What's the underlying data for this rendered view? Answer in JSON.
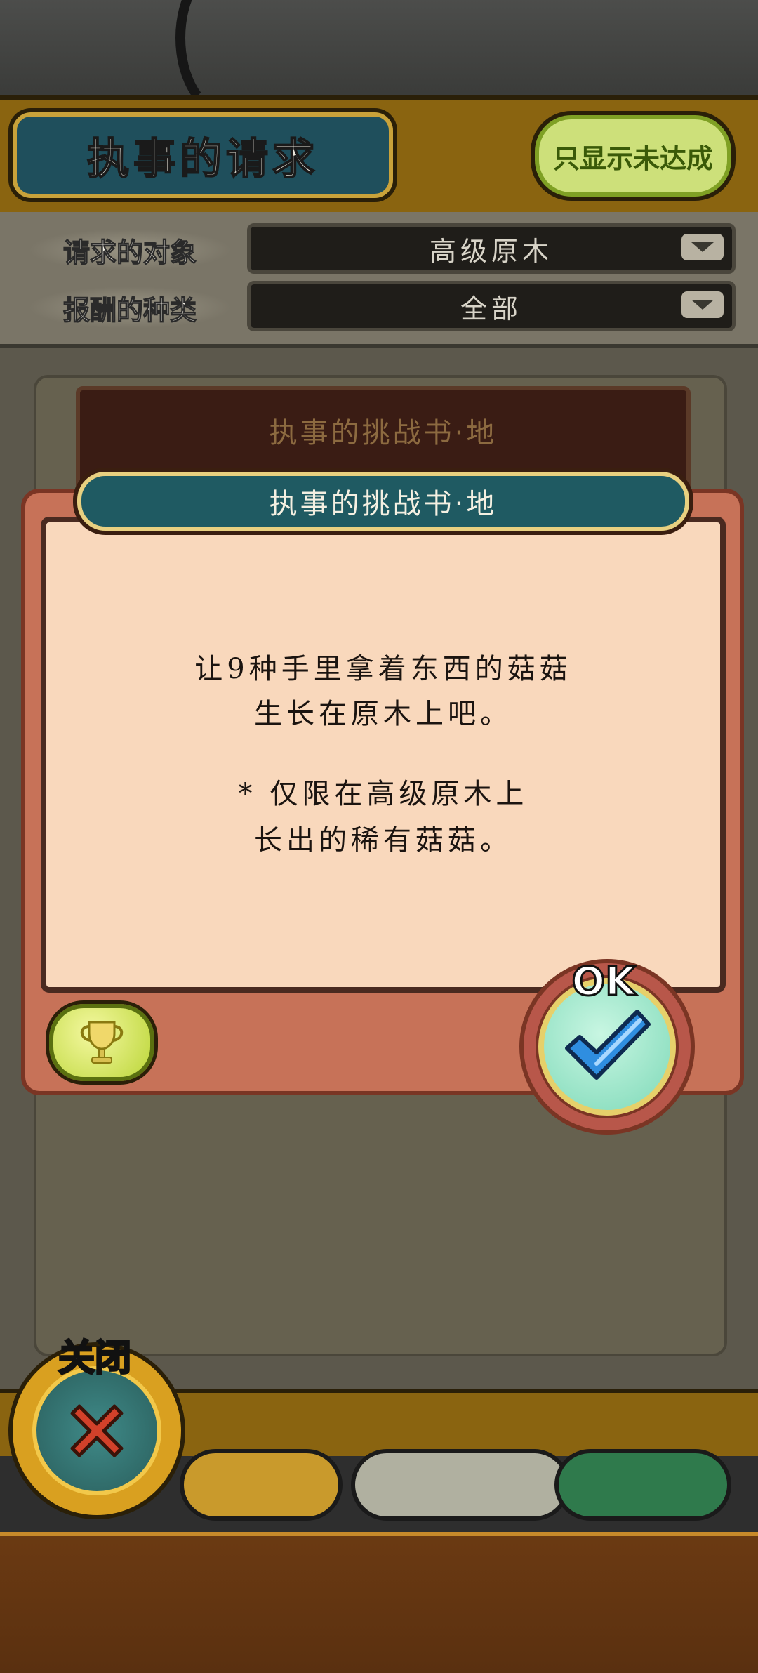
{
  "header": {
    "title": "执事的请求",
    "filter_button": "只显示未达成"
  },
  "filters": [
    {
      "label": "请求的对象",
      "value": "高级原木"
    },
    {
      "label": "报酬的种类",
      "value": "全部"
    }
  ],
  "list": {
    "card_title": "执事的挑战书·地"
  },
  "popup": {
    "title": "执事的挑战书·地",
    "lines": [
      "让9种手里拿着东西的菇菇",
      "生长在原木上吧。",
      "* 仅限在高级原木上",
      "长出的稀有菇菇。"
    ],
    "ok_label": "OK"
  },
  "close_label": "关闭",
  "colors": {
    "header": "#8a6410",
    "popup_frame": "#c77258",
    "popup_body": "#f9d8bc",
    "title_plate": "#1f4f5c",
    "filter_button": "#cde07a"
  },
  "icons": [
    "chevron-down-icon",
    "trophy-icon",
    "check-icon",
    "close-x-icon"
  ]
}
